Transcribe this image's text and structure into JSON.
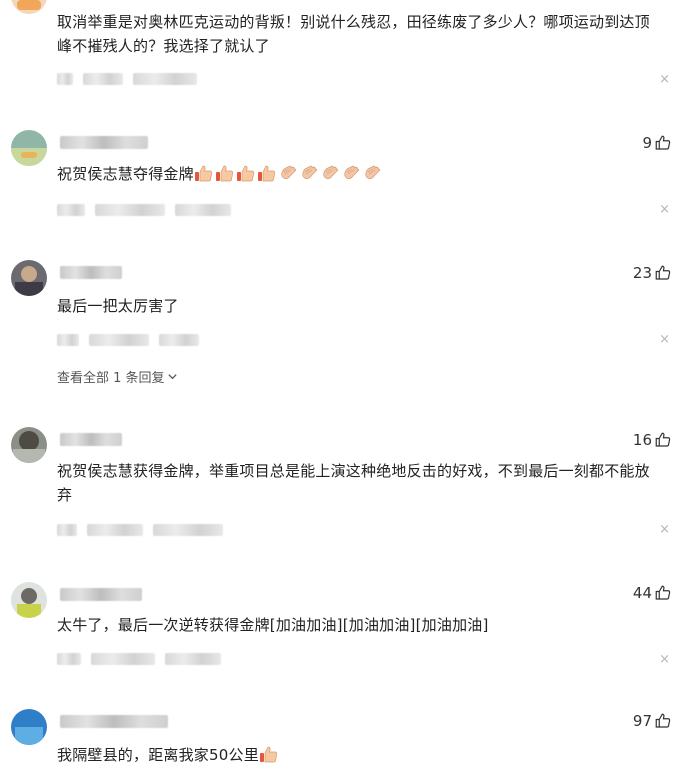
{
  "comments": [
    {
      "text": "取消举重是对奥林匹克运动的背叛！别说什么残忍，田径练废了多少人？哪项运动到达顶峰不摧残人的？我选择了就认了",
      "likes": ""
    },
    {
      "text": "祝贺侯志慧夺得金牌",
      "likes": "9",
      "emoji": [
        "thumbs-up-emoji",
        "thumbs-up-emoji",
        "thumbs-up-emoji",
        "thumbs-up-emoji",
        "clapping-emoji",
        "clapping-emoji",
        "clapping-emoji",
        "clapping-emoji",
        "clapping-emoji"
      ]
    },
    {
      "text": "最后一把太厉害了",
      "likes": "23",
      "replies_label": "查看全部 1 条回复"
    },
    {
      "text": "祝贺侯志慧获得金牌，举重项目总是能上演这种绝地反击的好戏，不到最后一刻都不能放弃",
      "likes": "16"
    },
    {
      "text": "太牛了，最后一次逆转获得金牌[加油加油][加油加油][加油加油]",
      "likes": "44"
    },
    {
      "text": "我隔壁县的，距离我家50公里",
      "likes": "97",
      "emoji": [
        "thumbs-up-emoji"
      ]
    }
  ],
  "icons": {
    "like": "thumbs-up-outline-icon",
    "close": "close-icon",
    "chevron": "chevron-down-icon"
  },
  "close_symbol": "×"
}
